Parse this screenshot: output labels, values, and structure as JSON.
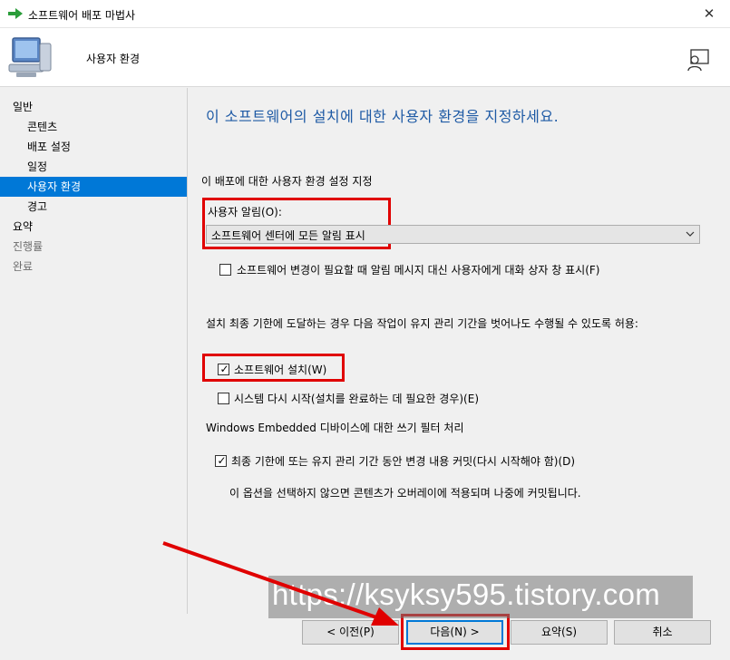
{
  "window": {
    "title": "소프트웨어 배포 마법사",
    "close_glyph": "✕"
  },
  "header": {
    "title": "사용자 환경"
  },
  "sidebar": {
    "items": [
      {
        "label": "일반",
        "level": "top",
        "state": "normal"
      },
      {
        "label": "콘텐츠",
        "level": "sub",
        "state": "normal"
      },
      {
        "label": "배포 설정",
        "level": "sub",
        "state": "normal"
      },
      {
        "label": "일정",
        "level": "sub",
        "state": "normal"
      },
      {
        "label": "사용자 환경",
        "level": "sub",
        "state": "active"
      },
      {
        "label": "경고",
        "level": "sub",
        "state": "normal"
      },
      {
        "label": "요약",
        "level": "top",
        "state": "normal"
      },
      {
        "label": "진행률",
        "level": "top",
        "state": "disabled"
      },
      {
        "label": "완료",
        "level": "top",
        "state": "disabled"
      }
    ]
  },
  "content": {
    "title": "이 소프트웨어의 설치에 대한 사용자 환경을 지정하세요.",
    "section_label": "이 배포에 대한 사용자 환경 설정 지정",
    "notification": {
      "label": "사용자 알림(O):",
      "selected": "소프트웨어 센터에 모든 알림 표시"
    },
    "dialog_checkbox": {
      "label": "소프트웨어 변경이 필요할 때 알림 메시지 대신 사용자에게 대화 상자 창 표시(F)",
      "checked": false
    },
    "deadline_label": "설치 최종 기한에 도달하는 경우 다음 작업이 유지 관리 기간을 벗어나도 수행될 수 있도록 허용:",
    "install_checkbox": {
      "label": "소프트웨어 설치(W)",
      "checked": true
    },
    "restart_checkbox": {
      "label": "시스템 다시 시작(설치를 완료하는 데 필요한 경우)(E)",
      "checked": false
    },
    "filter_label": "Windows Embedded 디바이스에 대한 쓰기 필터 처리",
    "commit_checkbox": {
      "label": "최종 기한에 또는 유지 관리 기간 동안 변경 내용 커밋(다시 시작해야 함)(D)",
      "checked": true
    },
    "commit_note": "이 옵션을 선택하지 않으면 콘텐츠가 오버레이에 적용되며 나중에 커밋됩니다."
  },
  "footer": {
    "prev": "< 이전(P)",
    "next": "다음(N) >",
    "summary": "요약(S)",
    "cancel": "취소"
  },
  "watermark": {
    "text": "https://ksyksy595.tistory.com"
  },
  "colors": {
    "accent": "#0078d7",
    "annotation_red": "#e00000",
    "title_blue": "#1e5aa5"
  },
  "icons": {
    "title": "green-arrow-icon",
    "header": "computer-icon",
    "help": "user-help-icon",
    "check": "✓",
    "dropdown": "chevron-down-icon"
  }
}
